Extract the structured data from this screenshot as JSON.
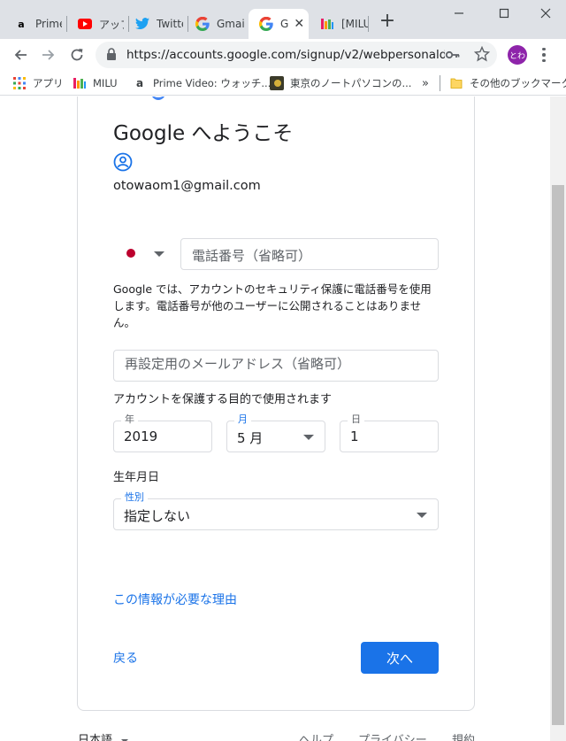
{
  "tabs": [
    {
      "title": "Prime",
      "icon": "amazon-icon"
    },
    {
      "title": "アップ",
      "icon": "youtube-icon"
    },
    {
      "title": "Twitte",
      "icon": "twitter-icon"
    },
    {
      "title": "Gmai",
      "icon": "google-icon"
    },
    {
      "title": "G",
      "icon": "google-icon",
      "active": true
    },
    {
      "title": "[MILU",
      "icon": "milu-icon"
    }
  ],
  "toolbar": {
    "url": "https://accounts.google.com/signup/v2/webpersonald...",
    "profile_initials": "とわ"
  },
  "bookmarks": {
    "items": [
      {
        "label": "アプリ",
        "icon": "apps-grid-icon"
      },
      {
        "label": "MILU",
        "icon": "milu-icon"
      },
      {
        "label": "Prime Video: ウォッチ...",
        "icon": "amazon-icon"
      },
      {
        "label": "東京のノートパソコンの...",
        "icon": "site-icon"
      }
    ],
    "more": "»",
    "other_label": "その他のブックマーク"
  },
  "page": {
    "title": "Google へようこそ",
    "email": "otowaom1@gmail.com",
    "phone_placeholder": "電話番号（省略可）",
    "phone_note": "Google では、アカウントのセキュリティ保護に電話番号を使用します。電話番号が他のユーザーに公開されることはありません。",
    "recovery_placeholder": "再設定用のメールアドレス（省略可）",
    "recovery_note": "アカウントを保護する目的で使用されます",
    "year_label": "年",
    "year_value": "2019",
    "month_label": "月",
    "month_value": "5 月",
    "day_label": "日",
    "day_value": "1",
    "birthday_note": "生年月日",
    "gender_label": "性別",
    "gender_value": "指定しない",
    "why_link": "この情報が必要な理由",
    "back_label": "戻る",
    "next_label": "次へ"
  },
  "footer": {
    "language": "日本語",
    "help": "ヘルプ",
    "privacy": "プライバシー",
    "terms": "規約"
  },
  "colors": {
    "accent": "#1a73e8",
    "profile": "#8e24aa",
    "flag": "#bc002d"
  }
}
